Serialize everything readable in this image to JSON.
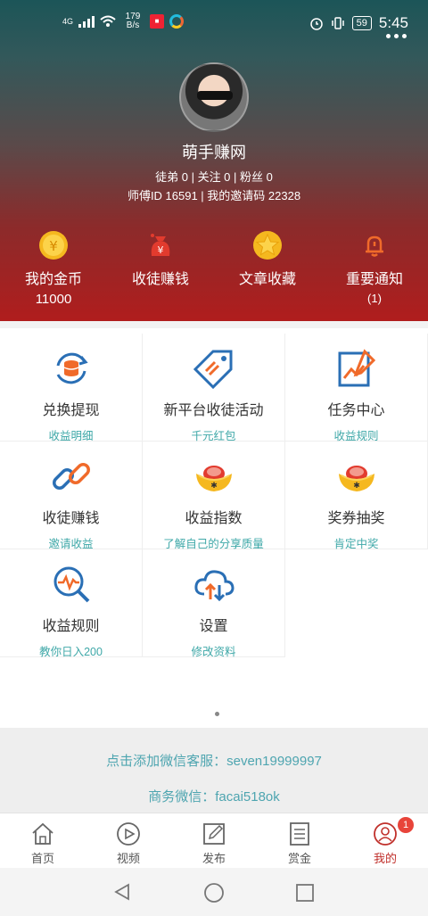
{
  "status_bar": {
    "network": "4G",
    "speed": "179 B/s",
    "battery": "59",
    "time": "5:45"
  },
  "profile": {
    "nickname": "萌手赚网",
    "stats_line": "徒弟 0 | 关注 0 | 粉丝 0",
    "ids_line": "师傅ID 16591 | 我的邀请码 22328"
  },
  "quick_actions": [
    {
      "label": "我的金币",
      "sub": "11000",
      "icon": "gold-coin-icon"
    },
    {
      "label": "收徒赚钱",
      "sub": "",
      "icon": "money-bag-icon"
    },
    {
      "label": "文章收藏",
      "sub": "",
      "icon": "star-badge-icon"
    },
    {
      "label": "重要通知",
      "sub": "(1)",
      "icon": "bell-icon"
    }
  ],
  "grid_items": [
    {
      "label": "兑换提现",
      "sub": "收益明细",
      "icon": "exchange-coins-icon"
    },
    {
      "label": "新平台收徒活动",
      "sub": "千元红包",
      "icon": "tag-icon"
    },
    {
      "label": "任务中心",
      "sub": "收益规则",
      "icon": "task-chart-icon"
    },
    {
      "label": "收徒赚钱",
      "sub": "邀请收益",
      "icon": "link-icon"
    },
    {
      "label": "收益指数",
      "sub": "了解自己的分享质量",
      "icon": "gold-ingot-icon"
    },
    {
      "label": "奖券抽奖",
      "sub": "肯定中奖",
      "icon": "gold-ingot-icon"
    },
    {
      "label": "收益规则",
      "sub": "教你日入200",
      "icon": "pulse-search-icon"
    },
    {
      "label": "设置",
      "sub": "修改资料",
      "icon": "cloud-sync-icon"
    }
  ],
  "contact": {
    "wechat_service": "点击添加微信客服：seven19999997",
    "business_wechat": "商务微信：facai518ok"
  },
  "tabs": [
    {
      "label": "首页",
      "icon": "home-icon"
    },
    {
      "label": "视频",
      "icon": "play-icon"
    },
    {
      "label": "发布",
      "icon": "edit-icon"
    },
    {
      "label": "赏金",
      "icon": "list-icon"
    },
    {
      "label": "我的",
      "icon": "user-icon",
      "badge": "1"
    }
  ],
  "colors": {
    "accent_red": "#c0302b",
    "link_teal": "#3fa8a8",
    "icon_blue": "#2a6fb5"
  }
}
